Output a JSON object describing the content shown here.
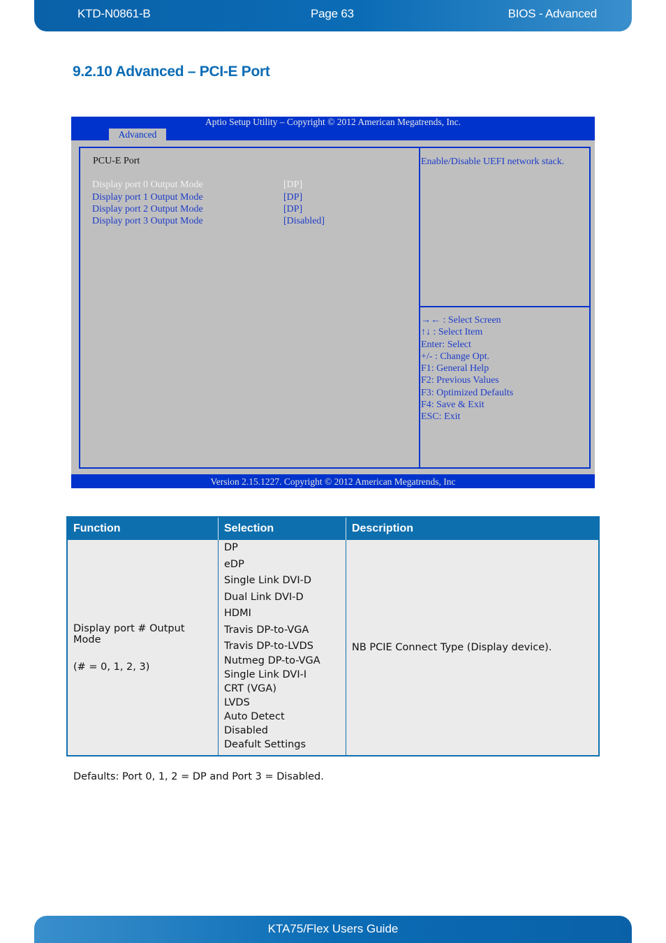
{
  "header": {
    "doc_id": "KTD-N0861-B",
    "page": "Page 63",
    "section": "BIOS  - Advanced"
  },
  "section_title": "9.2.10  Advanced – PCI-E Port",
  "bios": {
    "top_title": "Aptio Setup Utility  –  Copyright © 2012 American Megatrends, Inc.",
    "active_tab": "Advanced",
    "panel_title": "PCU-E Port",
    "options": [
      {
        "label": "Display port 0 Output Mode",
        "value": "[DP]",
        "selected": true
      },
      {
        "label": "Display port 1 Output Mode",
        "value": "[DP]",
        "selected": false
      },
      {
        "label": "Display port 2 Output Mode",
        "value": "[DP]",
        "selected": false
      },
      {
        "label": "Display port 3 Output Mode",
        "value": "[Disabled]",
        "selected": false
      }
    ],
    "help_text": "Enable/Disable UEFI network stack.",
    "keys": [
      "→← : Select Screen",
      "↑↓ : Select Item",
      "Enter: Select",
      "+/- : Change Opt.",
      "F1: General Help",
      "F2: Previous Values",
      "F3: Optimized Defaults",
      "F4: Save & Exit",
      "ESC: Exit"
    ],
    "bottom_text": "Version 2.15.1227. Copyright © 2012 American Megatrends, Inc",
    "colors": {
      "bar": "#0033cc",
      "panel": "#bfbfbf",
      "option_text": "#1e3cc8",
      "selected_text": "#f2f2f2"
    }
  },
  "table": {
    "headers": [
      "Function",
      "Selection",
      "Description"
    ],
    "row": {
      "function_lines": [
        "Display port # Output Mode",
        "(# = 0, 1, 2, 3)"
      ],
      "selections": [
        "DP",
        "eDP",
        "Single Link DVI-D",
        "Dual Link DVI-D",
        "HDMI",
        "Travis DP-to-VGA",
        "Travis DP-to-LVDS",
        "Nutmeg DP-to-VGA",
        "Single Link DVI-I",
        "CRT (VGA)",
        "LVDS",
        "Auto Detect",
        "Disabled",
        "Deafult Settings"
      ],
      "description": "NB PCIE Connect Type (Display device)."
    }
  },
  "defaults_note": "Defaults: Port 0, 1, 2 = DP and Port 3 = Disabled.",
  "footer": {
    "title": "KTA75/Flex Users Guide"
  }
}
